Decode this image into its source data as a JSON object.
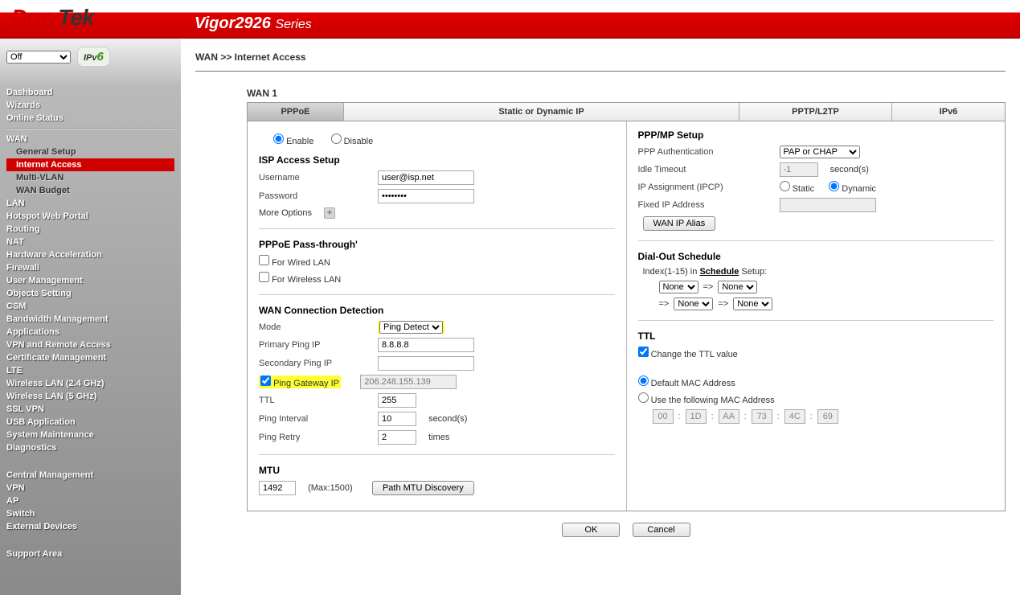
{
  "brand": {
    "d": "Dray",
    "t": "Tek",
    "model": "Vigor2926",
    "series": "Series"
  },
  "sidebar": {
    "mode_select": "Off",
    "ipv6": "IPv6",
    "items_a": [
      "Dashboard",
      "Wizards",
      "Online Status"
    ],
    "wan": {
      "label": "WAN",
      "subs": [
        "General Setup",
        "Internet Access",
        "Multi-VLAN",
        "WAN Budget"
      ],
      "active": 1
    },
    "items_b": [
      "LAN",
      "Hotspot Web Portal",
      "Routing",
      "NAT",
      "Hardware Acceleration",
      "Firewall",
      "User Management",
      "Objects Setting",
      "CSM",
      "Bandwidth Management",
      "Applications",
      "VPN and Remote Access",
      "Certificate Management",
      "LTE",
      "Wireless LAN (2.4 GHz)",
      "Wireless LAN (5 GHz)",
      "SSL VPN",
      "USB Application",
      "System Maintenance",
      "Diagnostics"
    ],
    "items_c_title": "Central Management",
    "items_c": [
      "VPN",
      "AP",
      "Switch",
      "External Devices"
    ],
    "support": "Support Area"
  },
  "breadcrumb": "WAN >> Internet Access",
  "wan_label": "WAN 1",
  "tabs": [
    "PPPoE",
    "Static or Dynamic IP",
    "PPTP/L2TP",
    "IPv6"
  ],
  "enable": {
    "enable": "Enable",
    "disable": "Disable"
  },
  "isp": {
    "title": "ISP Access Setup",
    "username_label": "Username",
    "username": "user@isp.net",
    "password_label": "Password",
    "password": "••••••••",
    "more": "More Options"
  },
  "pass": {
    "title": "PPPoE Pass-through'",
    "wired": "For Wired LAN",
    "wireless": "For Wireless LAN"
  },
  "wcd": {
    "title": "WAN Connection Detection",
    "mode_label": "Mode",
    "mode": "Ping Detect",
    "pip_label": "Primary Ping IP",
    "pip": "8.8.8.8",
    "sip_label": "Secondary Ping IP",
    "sip": "",
    "gw_label": "Ping Gateway IP",
    "gw": "206.248.155.139",
    "ttl_label": "TTL",
    "ttl": "255",
    "int_label": "Ping Interval",
    "int": "10",
    "int_unit": "second(s)",
    "retry_label": "Ping Retry",
    "retry": "2",
    "retry_unit": "times"
  },
  "mtu": {
    "title": "MTU",
    "val": "1492",
    "max": "(Max:1500)",
    "btn": "Path MTU Discovery"
  },
  "ppp": {
    "title": "PPP/MP Setup",
    "auth_label": "PPP Authentication",
    "auth": "PAP or CHAP",
    "idle_label": "Idle Timeout",
    "idle": "-1",
    "idle_unit": "second(s)",
    "ipcp_label": "IP Assignment (IPCP)",
    "static": "Static",
    "dynamic": "Dynamic",
    "fixed_label": "Fixed IP Address",
    "alias": "WAN IP Alias"
  },
  "sched": {
    "title": "Dial-Out Schedule",
    "line": "Index(1-15) in",
    "link": "Schedule",
    "suffix": "Setup:",
    "none": "None",
    "arrow": "=>"
  },
  "ttl": {
    "title": "TTL",
    "change": "Change the TTL value"
  },
  "mac": {
    "def": "Default MAC Address",
    "use": "Use the following MAC Address",
    "oct": [
      "00",
      "1D",
      "AA",
      "73",
      "4C",
      "69"
    ]
  },
  "buttons": {
    "ok": "OK",
    "cancel": "Cancel"
  }
}
